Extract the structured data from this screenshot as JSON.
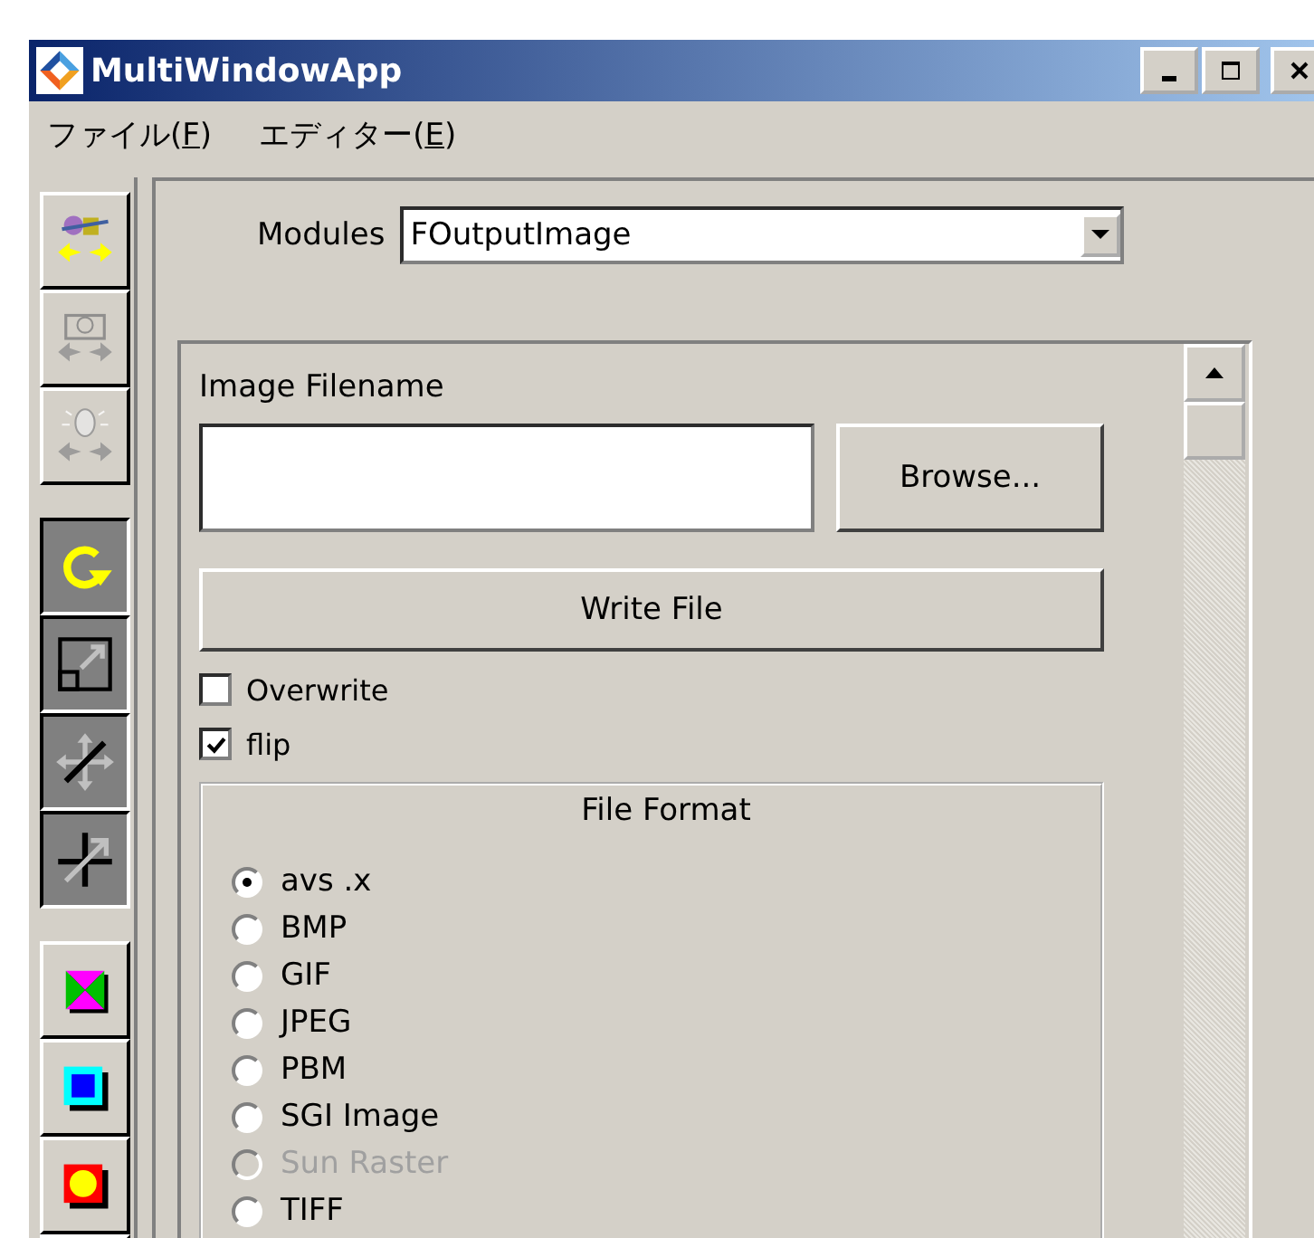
{
  "window": {
    "title": "MultiWindowApp"
  },
  "menu": [
    {
      "label": "ファイル(",
      "accel": "F",
      "suffix": ")"
    },
    {
      "label": "エディター(",
      "accel": "E",
      "suffix": ")"
    }
  ],
  "toolbar_groups": [
    [
      {
        "kind": "objects",
        "pressed": false,
        "disabled": false
      },
      {
        "kind": "camera",
        "pressed": false,
        "disabled": true
      },
      {
        "kind": "light",
        "pressed": false,
        "disabled": true
      }
    ],
    [
      {
        "kind": "rotate",
        "pressed": true,
        "disabled": false
      },
      {
        "kind": "scale",
        "pressed": true,
        "disabled": false
      },
      {
        "kind": "translate",
        "pressed": true,
        "disabled": false
      },
      {
        "kind": "zoom",
        "pressed": true,
        "disabled": false
      }
    ],
    [
      {
        "kind": "hourglass",
        "pressed": false,
        "disabled": false
      },
      {
        "kind": "square",
        "pressed": false,
        "disabled": false
      },
      {
        "kind": "circle",
        "pressed": false,
        "disabled": false
      },
      {
        "kind": "partial",
        "pressed": false
      }
    ]
  ],
  "modules": {
    "label": "Modules",
    "value": "FOutputImage"
  },
  "image_filename": {
    "label": "Image Filename"
  },
  "browse_button": "Browse...",
  "write_button": "Write File",
  "checkboxes": [
    {
      "label": "Overwrite",
      "checked": false
    },
    {
      "label": "flip",
      "checked": true
    }
  ],
  "file_format": {
    "title": "File Format",
    "options": [
      {
        "label": "avs .x",
        "selected": true,
        "disabled": false
      },
      {
        "label": "BMP",
        "selected": false,
        "disabled": false
      },
      {
        "label": "GIF",
        "selected": false,
        "disabled": false
      },
      {
        "label": "JPEG",
        "selected": false,
        "disabled": false
      },
      {
        "label": "PBM",
        "selected": false,
        "disabled": false
      },
      {
        "label": "SGI Image",
        "selected": false,
        "disabled": false
      },
      {
        "label": "Sun Raster",
        "selected": false,
        "disabled": true
      },
      {
        "label": "TIFF",
        "selected": false,
        "disabled": false
      }
    ]
  }
}
